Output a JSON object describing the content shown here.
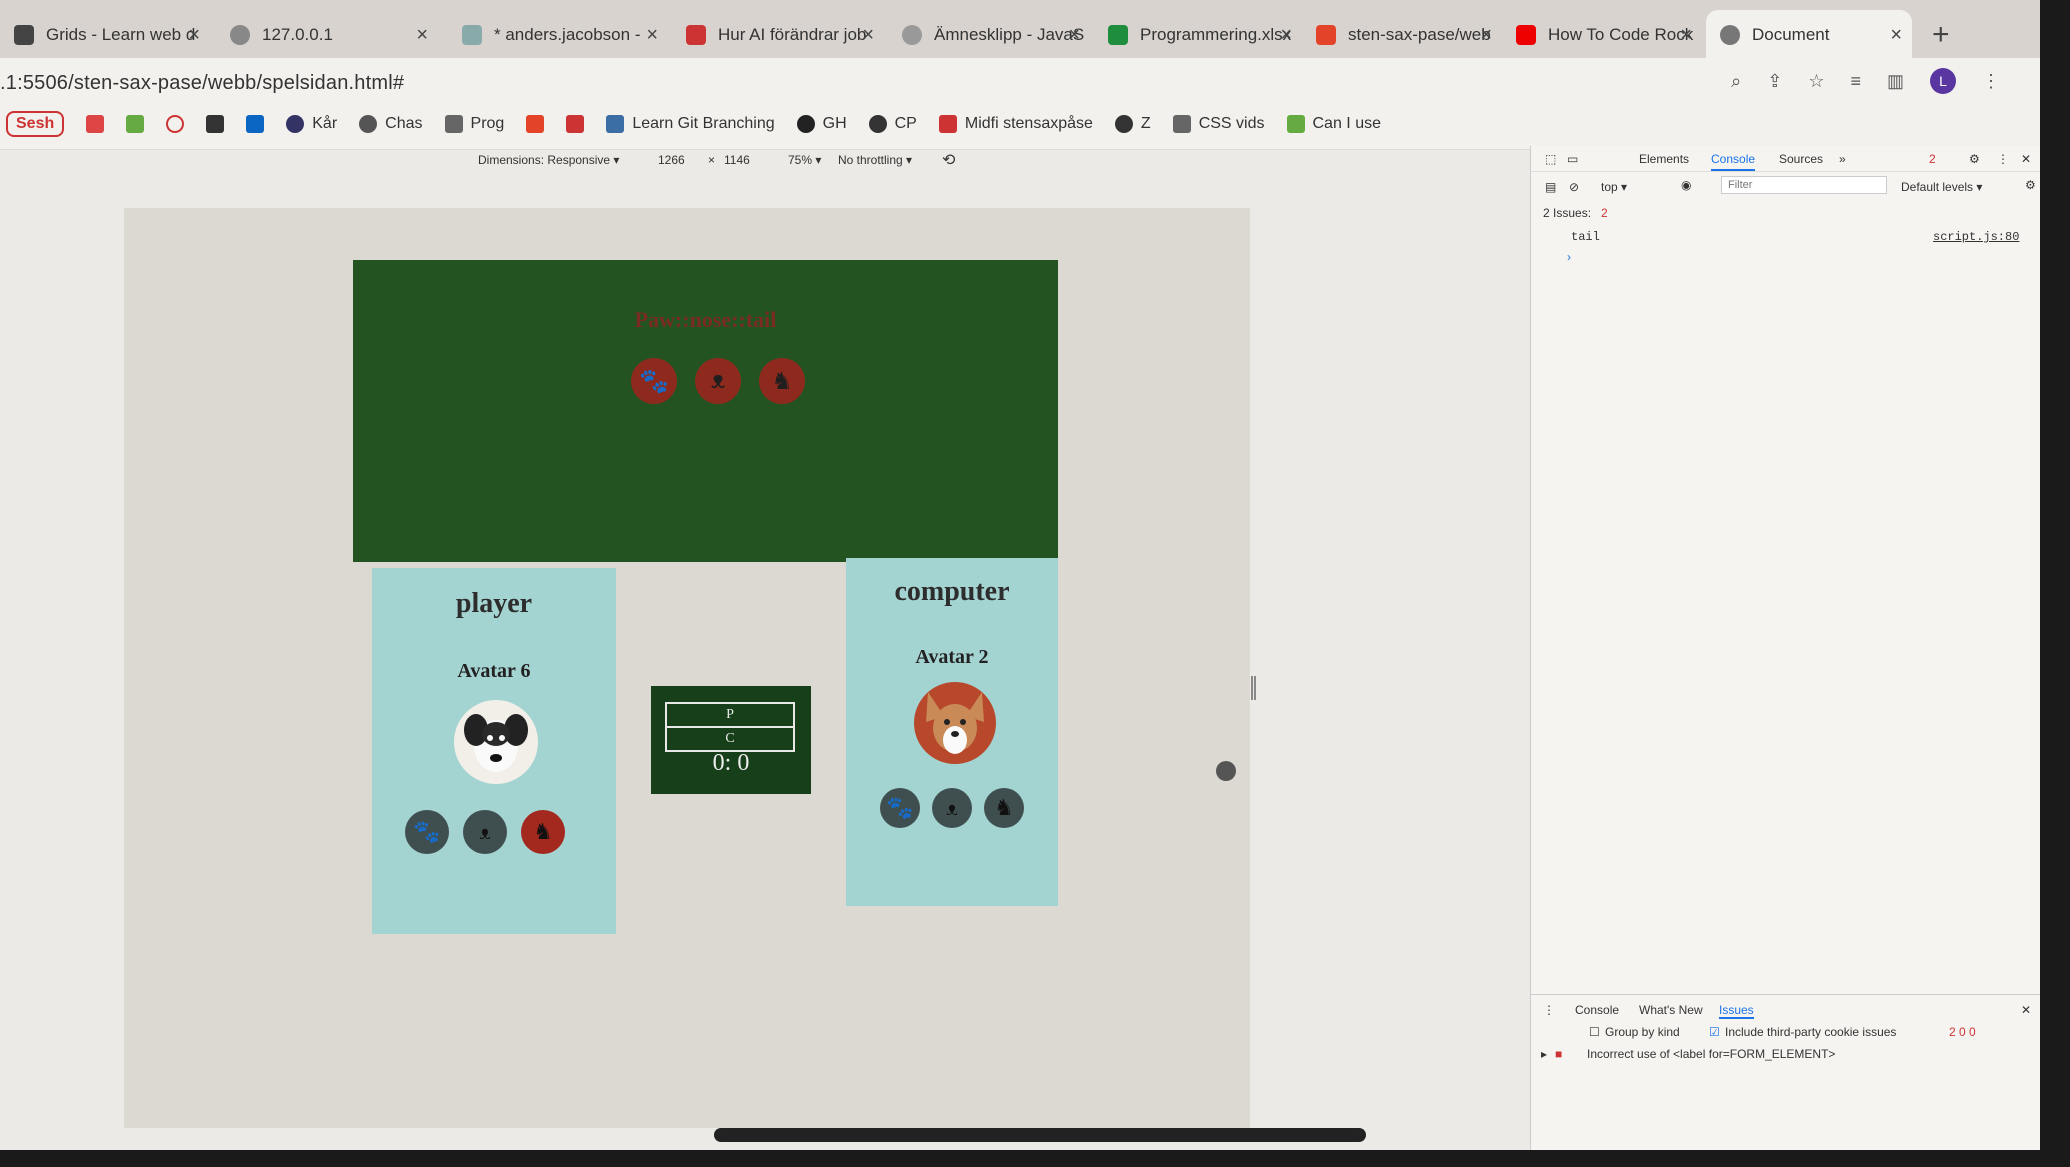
{
  "browser": {
    "tabs": [
      {
        "label": "Grids - Learn web d",
        "active": false
      },
      {
        "label": "127.0.0.1",
        "active": false
      },
      {
        "label": "* anders.jacobson -",
        "active": false
      },
      {
        "label": "Hur AI förändrar job",
        "active": false
      },
      {
        "label": "Ämnesklipp - JavaS",
        "active": false
      },
      {
        "label": "Programmering.xlsx",
        "active": false
      },
      {
        "label": "sten-sax-pase/web",
        "active": false
      },
      {
        "label": "How To Code Rock",
        "active": false
      },
      {
        "label": "Document",
        "active": true
      }
    ],
    "close_glyph": "×",
    "new_tab": "+",
    "url": ".1:5506/sten-sax-pase/webb/spelsidan.html#",
    "profile_initial": "L",
    "bookmarks": [
      "Sesh",
      "Kår",
      "Chas",
      "Prog",
      "Learn Git Branching",
      "GH",
      "CP",
      "Midfi stensaxpåse",
      "Z",
      "CSS vids",
      "Can I use"
    ]
  },
  "device_toolbar": {
    "dimensions": "Dimensions: Responsive ▾",
    "width": "1266",
    "times": "×",
    "height": "1146",
    "zoom": "75% ▾",
    "throttle": "No throttling ▾"
  },
  "game": {
    "title": "Paw::nose::tail",
    "choice_icons": [
      "paw-icon",
      "dog-nose-icon",
      "dog-tail-icon"
    ],
    "player": {
      "heading": "player",
      "avatar_name": "Avatar 6",
      "selected_index": 2
    },
    "computer": {
      "heading": "computer",
      "avatar_name": "Avatar 2",
      "selected_index": -1
    },
    "score": {
      "p_label": "P",
      "c_label": "C",
      "value": "0: 0"
    }
  },
  "devtools": {
    "tabs": [
      "Elements",
      "Console",
      "Sources",
      "»"
    ],
    "active_tab": "Console",
    "issue_badge": "2",
    "context": "top ▾",
    "filter_placeholder": "Filter",
    "levels": "Default levels ▾",
    "issues_summary": "2 Issues:",
    "issues_count": "2",
    "log_text": "tail",
    "log_source": "script.js:80",
    "prompt": "›",
    "drawer_tabs": [
      "Console",
      "What's New",
      "Issues"
    ],
    "group_by_kind": "Group by kind",
    "third_party": "Include third-party cookie issues",
    "issue_counts": "2  0  0",
    "issue_message": "Incorrect use of <label for=FORM_ELEMENT>"
  },
  "colors": {
    "stage_bg": "#235321",
    "card_bg": "#a4d4d1",
    "selected_btn": "#a3281d",
    "idle_btn": "#3f4f4f",
    "title_text": "#7a2b22"
  }
}
